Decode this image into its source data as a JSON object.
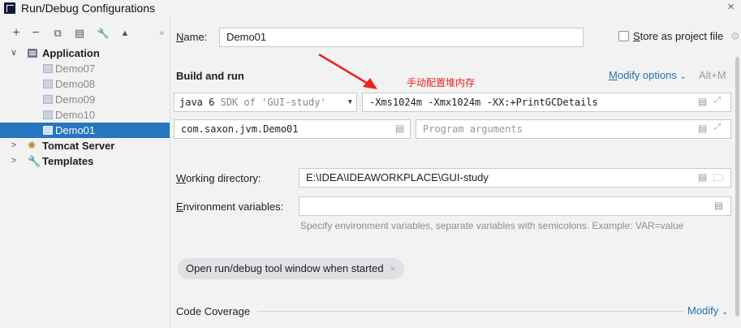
{
  "window": {
    "title": "Run/Debug Configurations",
    "close_glyph": "×"
  },
  "toolbar": {
    "add": "+",
    "remove": "−",
    "copy": "⧉",
    "save": "▤",
    "edit": "🔧",
    "move_up": "▲",
    "more": "»"
  },
  "tree": {
    "application": {
      "label": "Application",
      "chevron": "∨"
    },
    "children": [
      "Demo07",
      "Demo08",
      "Demo09",
      "Demo10",
      "Demo01"
    ],
    "selected": "Demo01",
    "tomcat": {
      "label": "Tomcat Server",
      "chevron": ">"
    },
    "templates": {
      "label": "Templates",
      "chevron": ">"
    }
  },
  "name": {
    "label": "Name:",
    "value": "Demo01"
  },
  "store_project": {
    "label": "Store as project file",
    "checked": false
  },
  "build_run": {
    "title": "Build and run",
    "modify_options": "Modify options",
    "modify_chevron": "⌄",
    "shortcut": "Alt+M",
    "sdk": {
      "java": "java",
      "version": "6",
      "rest": "SDK of 'GUI-study'"
    },
    "vm_options": "-Xms1024m -Xmx1024m -XX:+PrintGCDetails",
    "main_class": "com.saxon.jvm.Demo01",
    "program_args_placeholder": "Program arguments"
  },
  "annotation": {
    "text": "手动配置堆内存",
    "color": "#e8261c"
  },
  "working_dir": {
    "label": "Working directory:",
    "value": "E:\\IDEA\\IDEAWORKPLACE\\GUI-study"
  },
  "env": {
    "label": "Environment variables:",
    "value": "",
    "hint": "Specify environment variables, separate variables with semicolons. Example: VAR=value"
  },
  "chip": {
    "label": "Open run/debug tool window when started",
    "close": "×"
  },
  "code_coverage": {
    "title": "Code Coverage",
    "modify": "Modify"
  },
  "colors": {
    "selection": "#2675bf",
    "link": "#2470b3",
    "accent_red": "#e8261c"
  }
}
